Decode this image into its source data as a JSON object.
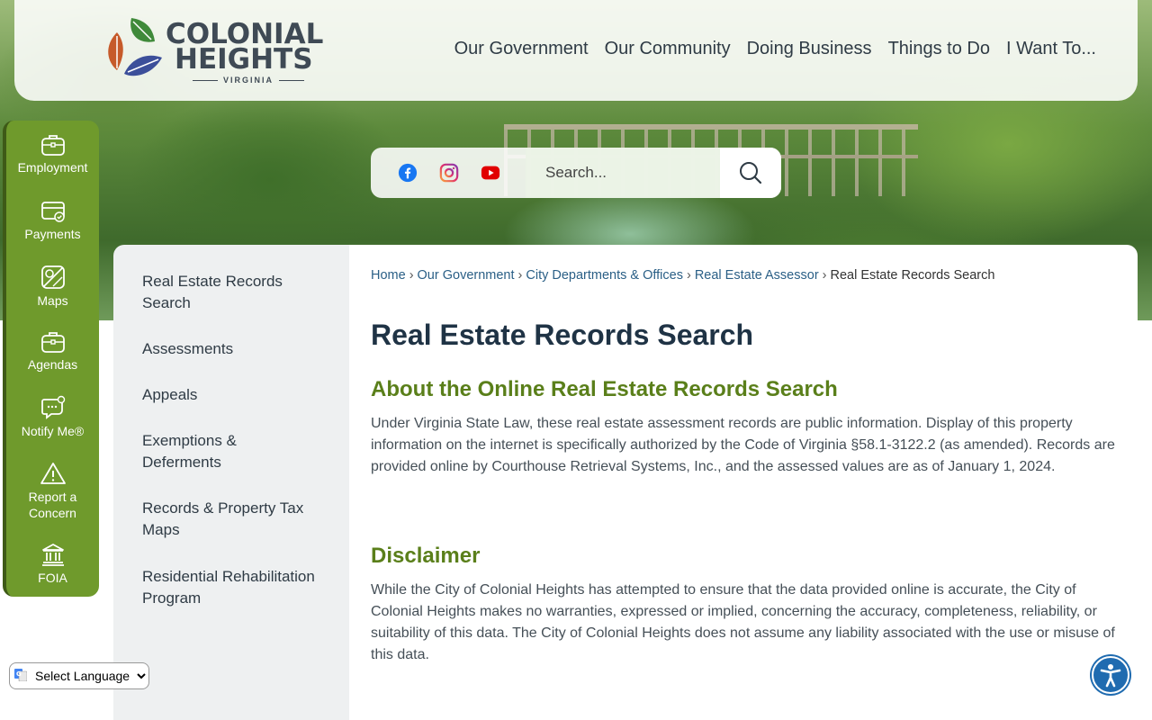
{
  "logo": {
    "line1": "COLONIAL",
    "line2": "HEIGHTS",
    "line3": "VIRGINIA"
  },
  "nav": [
    "Our Government",
    "Our Community",
    "Doing Business",
    "Things to Do",
    "I Want To..."
  ],
  "search": {
    "placeholder": "Search..."
  },
  "social": {
    "icons": [
      "facebook-icon",
      "instagram-icon",
      "youtube-icon"
    ]
  },
  "quicklinks": [
    "Employment",
    "Payments",
    "Maps",
    "Agendas",
    "Notify Me®",
    "Report a Concern",
    "FOIA"
  ],
  "sidebar": {
    "items": [
      "Real Estate Records Search",
      "Assessments",
      "Appeals",
      "Exemptions & Deferments",
      "Records & Property Tax Maps",
      "Residential Rehabilitation Program"
    ]
  },
  "breadcrumb": [
    "Home",
    "Our Government",
    "City Departments & Offices",
    "Real Estate Assessor",
    "Real Estate Records Search"
  ],
  "breadcrumb_sep": "›",
  "main": {
    "title": "Real Estate Records Search",
    "section1_heading": "About the Online Real Estate Records Search",
    "section1_text": "Under Virginia State Law, these real estate assessment records are public information. Display of this property information on the internet is specifically authorized by the Code of Virginia §58.1-3122.2 (as amended). Records are provided online by Courthouse Retrieval Systems, Inc., and the assessed values are as of January 1, 2024.",
    "section2_heading": "Disclaimer",
    "section2_text": "While the City of Colonial Heights has attempted to ensure that the data provided online is accurate, the City of Colonial Heights makes no warranties, expressed or implied, concerning the accuracy, completeness, reliability, or suitability of this data. The City of Colonial Heights does not assume any liability associated with the use or misuse of this data."
  },
  "language": {
    "selected": "Select Language"
  },
  "colors": {
    "green": "#6f9a2c",
    "heading_green": "#5a7f1a",
    "link_blue": "#2a5f86",
    "title_navy": "#1f3345",
    "access_blue": "#1f6bb0"
  }
}
